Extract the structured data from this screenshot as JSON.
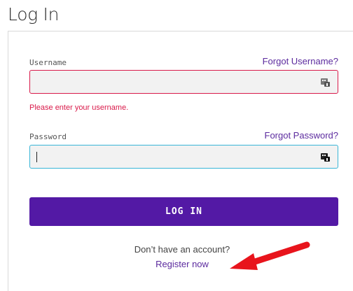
{
  "page": {
    "title": "Log In"
  },
  "form": {
    "username": {
      "label": "Username",
      "forgot_label": "Forgot Username?",
      "value": "",
      "placeholder": "",
      "error": "Please enter your username."
    },
    "password": {
      "label": "Password",
      "forgot_label": "Forgot Password?",
      "value": "",
      "placeholder": ""
    },
    "submit_label": "LOG IN"
  },
  "register": {
    "prompt": "Don’t have an account?",
    "link_label": "Register now"
  },
  "icons": {
    "username_field": "password-manager-icon",
    "password_field": "password-manager-icon",
    "annotation": "red-arrow-icon"
  },
  "colors": {
    "accent": "#5319a5",
    "link": "#5b2a9e",
    "error": "#d91a4a",
    "focus": "#38b5d6",
    "annotation": "#e8141c"
  }
}
